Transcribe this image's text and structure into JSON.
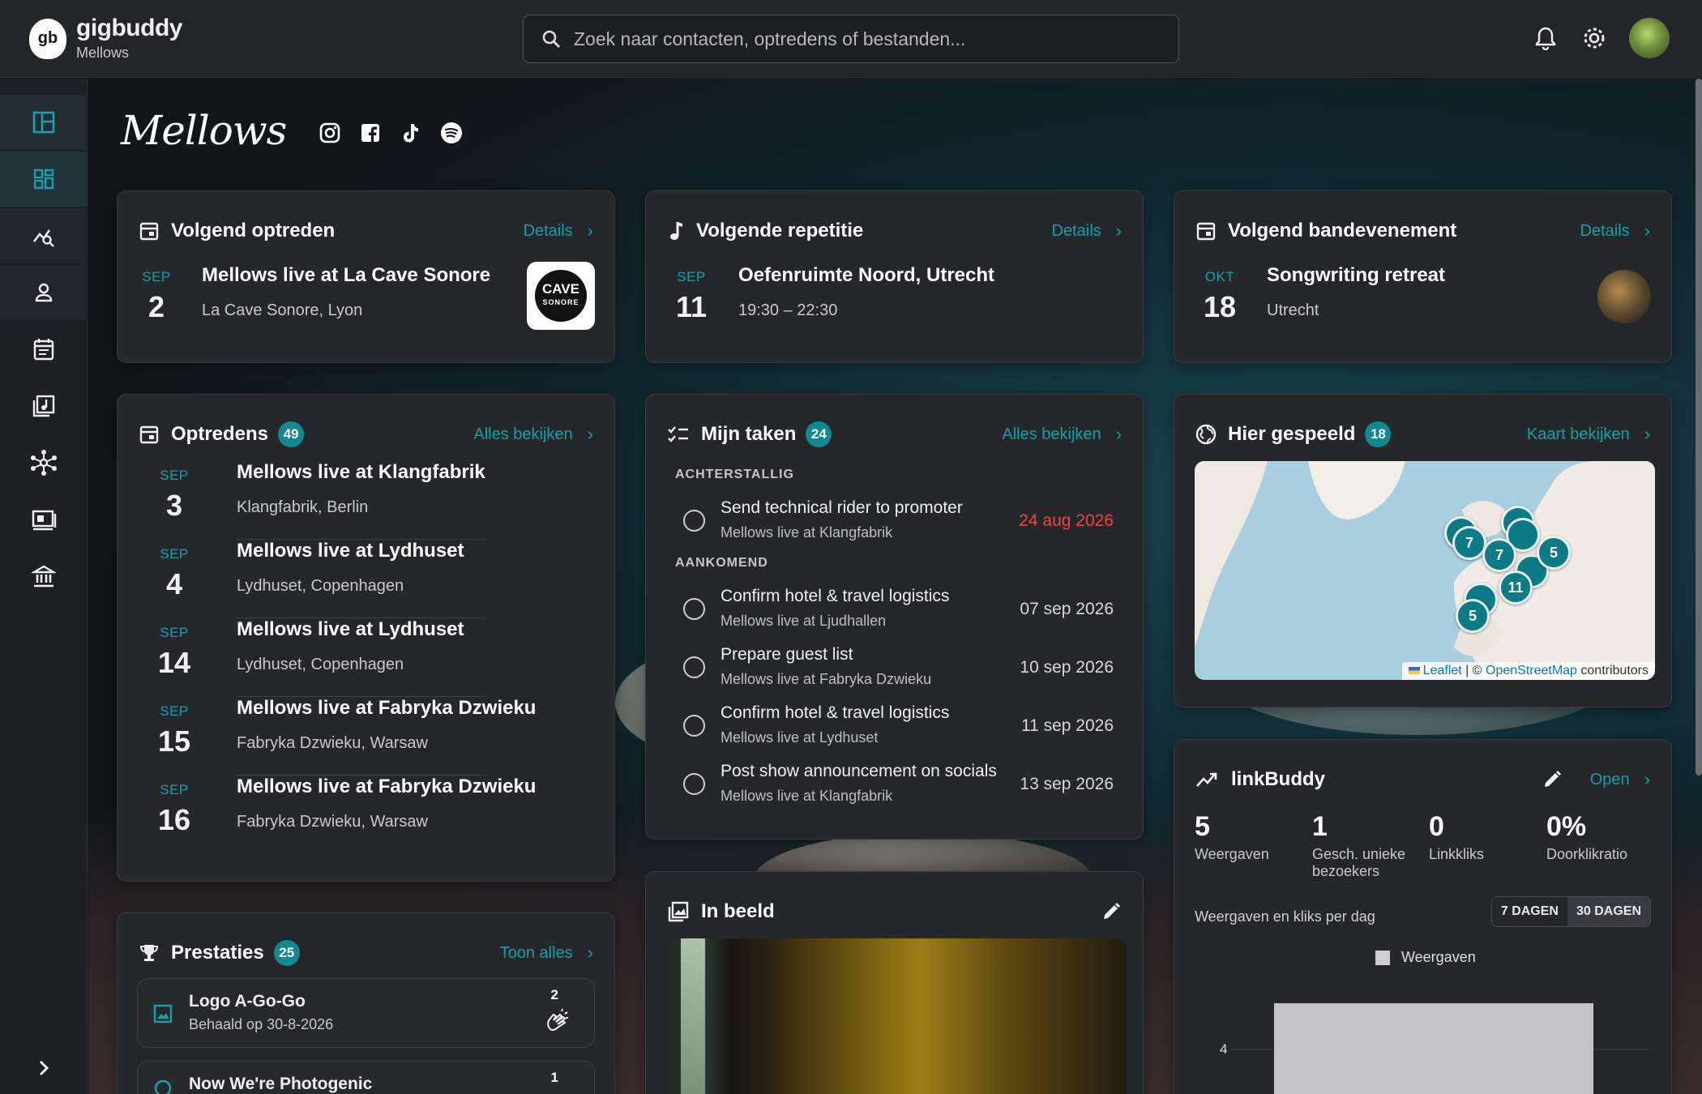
{
  "app": {
    "brand_name": "gigbuddy",
    "brand_sub": "Mellows",
    "search_placeholder": "Zoek naar contacten, optredens of bestanden..."
  },
  "band": {
    "name": "Mellows"
  },
  "colors": {
    "accent": "#0f8a93",
    "link": "#13a0a8",
    "overdue": "#ee4444",
    "card": "#26272b"
  },
  "next_gig": {
    "title": "Volgend optreden",
    "link": "Details",
    "month": "SEP",
    "day": "2",
    "event": "Mellows live at La Cave Sonore",
    "place": "La Cave Sonore, Lyon",
    "logo_text": "CAVE",
    "logo_sub": "SONORE"
  },
  "next_rehearsal": {
    "title": "Volgende repetitie",
    "link": "Details",
    "month": "SEP",
    "day": "11",
    "event": "Oefenruimte Noord, Utrecht",
    "time": "19:30 – 22:30"
  },
  "next_band_event": {
    "title": "Volgend bandevenement",
    "link": "Details",
    "month": "OKT",
    "day": "18",
    "event": "Songwriting retreat",
    "place": "Utrecht"
  },
  "gigs": {
    "title": "Optredens",
    "count": "49",
    "link": "Alles bekijken",
    "items": [
      {
        "month": "SEP",
        "day": "3",
        "title": "Mellows live at Klangfabrik",
        "place": "Klangfabrik, Berlin"
      },
      {
        "month": "SEP",
        "day": "4",
        "title": "Mellows live at Lydhuset",
        "place": "Lydhuset, Copenhagen"
      },
      {
        "month": "SEP",
        "day": "14",
        "title": "Mellows live at Lydhuset",
        "place": "Lydhuset, Copenhagen"
      },
      {
        "month": "SEP",
        "day": "15",
        "title": "Mellows live at Fabryka Dzwieku",
        "place": "Fabryka Dzwieku, Warsaw"
      },
      {
        "month": "SEP",
        "day": "16",
        "title": "Mellows live at Fabryka Dzwieku",
        "place": "Fabryka Dzwieku, Warsaw"
      }
    ]
  },
  "tasks": {
    "title": "Mijn taken",
    "count": "24",
    "link": "Alles bekijken",
    "overdue_label": "ACHTERSTALLIG",
    "upcoming_label": "AANKOMEND",
    "overdue": [
      {
        "title": "Send technical rider to promoter",
        "sub": "Mellows live at Klangfabrik",
        "date": "24 aug 2026"
      }
    ],
    "upcoming": [
      {
        "title": "Confirm hotel & travel logistics",
        "sub": "Mellows live at Ljudhallen",
        "date": "07 sep 2026"
      },
      {
        "title": "Prepare guest list",
        "sub": "Mellows live at Fabryka Dzwieku",
        "date": "10 sep 2026"
      },
      {
        "title": "Confirm hotel & travel logistics",
        "sub": "Mellows live at Lydhuset",
        "date": "11 sep 2026"
      },
      {
        "title": "Post show announcement on socials",
        "sub": "Mellows live at Klangfabrik",
        "date": "13 sep 2026"
      }
    ]
  },
  "played_here": {
    "title": "Hier gespeeld",
    "count": "18",
    "link": "Kaart bekijken",
    "attribution_leaflet": "Leaflet",
    "attribution_sep": " | © ",
    "attribution_osm": "OpenStreetMap",
    "attribution_tail": " contributors",
    "clusters": [
      "7",
      "7",
      "11",
      "5",
      "5"
    ]
  },
  "linkbuddy": {
    "title": "linkBuddy",
    "link": "Open",
    "stats": [
      {
        "value": "5",
        "label": "Weergaven"
      },
      {
        "value": "1",
        "label": "Gesch. unieke bezoekers"
      },
      {
        "value": "0",
        "label": "Linkkliks"
      },
      {
        "value": "0%",
        "label": "Doorklikratio"
      }
    ],
    "chart_caption": "Weergaven en kliks per dag",
    "range_7": "7 DAGEN",
    "range_30": "30 DAGEN",
    "legend": "Weergaven",
    "y_tick": "4"
  },
  "achievements": {
    "title": "Prestaties",
    "count": "25",
    "link": "Toon alles",
    "items": [
      {
        "title": "Logo A-Go-Go",
        "sub": "Behaald op 30-8-2026",
        "count": "2"
      },
      {
        "title": "Now We're Photogenic",
        "sub": "",
        "count": "1"
      }
    ]
  },
  "gallery": {
    "title": "In beeld"
  }
}
